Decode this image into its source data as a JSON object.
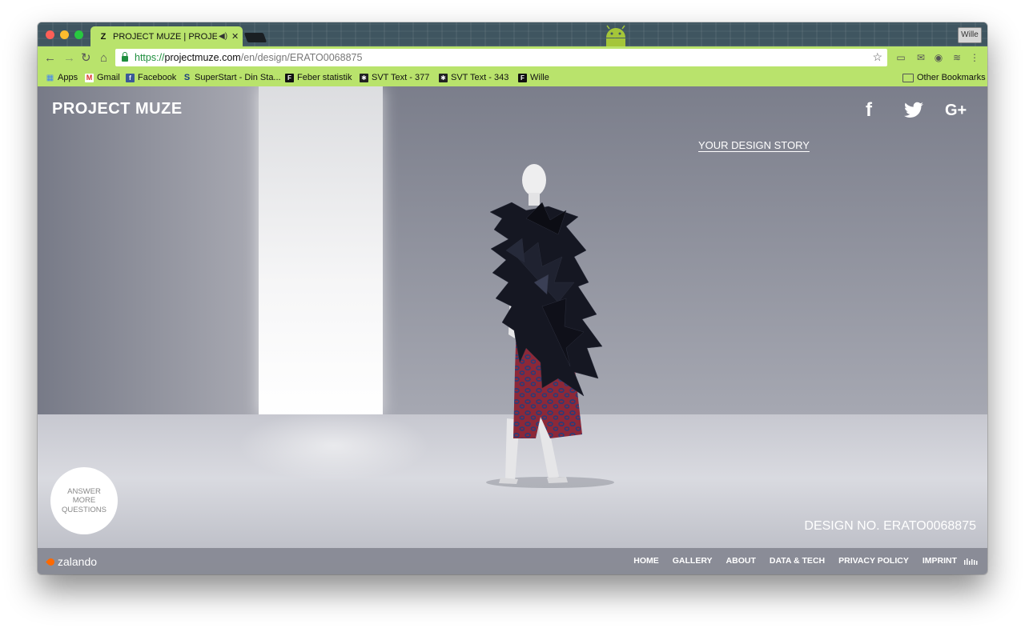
{
  "browser": {
    "tab": {
      "title": "PROJECT MUZE | PROJECT",
      "favicon": "Z",
      "audio_icon": "speaker-icon",
      "close_label": "✕"
    },
    "profile_label": "Wille",
    "address": {
      "scheme": "https://",
      "host": "projectmuze.com",
      "path": "/en/design/ERATO0068875"
    },
    "bookmarks": [
      {
        "label": "Apps",
        "icon": "apps-grid-icon"
      },
      {
        "label": "Gmail",
        "icon": "gmail-icon"
      },
      {
        "label": "Facebook",
        "icon": "facebook-icon"
      },
      {
        "label": "SuperStart - Din Sta...",
        "icon": "superstart-icon"
      },
      {
        "label": "Feber statistik",
        "icon": "feber-icon"
      },
      {
        "label": "SVT Text - 377",
        "icon": "svt-icon"
      },
      {
        "label": "SVT Text - 343",
        "icon": "svt-icon"
      },
      {
        "label": "Wille",
        "icon": "feber-icon"
      }
    ],
    "other_bookmarks": "Other Bookmarks"
  },
  "page": {
    "logo": "PROJECT MUZE",
    "story_link": "YOUR DESIGN STORY",
    "answer_button": "ANSWER MORE QUESTIONS",
    "design_number": "DESIGN NO. ERATO0068875",
    "social": {
      "facebook": "f",
      "google_plus": "G+"
    },
    "footer": {
      "brand": "zalando",
      "links": [
        "HOME",
        "GALLERY",
        "ABOUT",
        "DATA & TECH",
        "PRIVACY POLICY",
        "IMPRINT"
      ]
    }
  },
  "colors": {
    "chrome_theme": "#b9e36c",
    "tab_strip": "#3f5560",
    "zalando_orange": "#ff6900"
  }
}
